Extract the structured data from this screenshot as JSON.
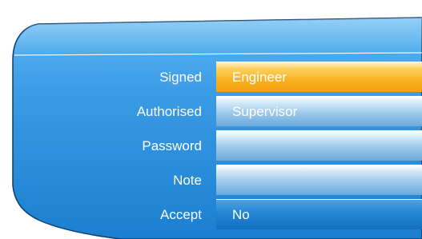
{
  "form": {
    "rows": [
      {
        "label": "Signed",
        "value": "Engineer",
        "state": "selected"
      },
      {
        "label": "Authorised",
        "value": "Supervisor",
        "state": "normal"
      },
      {
        "label": "Password",
        "value": "",
        "state": "normal"
      },
      {
        "label": "Note",
        "value": "",
        "state": "normal"
      },
      {
        "label": "Accept",
        "value": "No",
        "state": "dark"
      }
    ]
  },
  "colors": {
    "panel_top": "#47a9ef",
    "panel_bottom": "#1a7fd0",
    "selected_field": "#f8b122",
    "text": "#ffffff"
  }
}
